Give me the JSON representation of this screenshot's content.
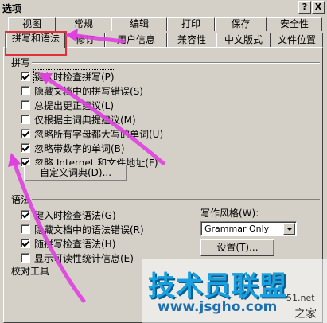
{
  "window": {
    "title": "选项",
    "help_btn": "?",
    "close_btn": "X"
  },
  "tabs_row1": [
    "视图",
    "常规",
    "编辑",
    "打印",
    "保存",
    "安全性"
  ],
  "tabs_row2": [
    "拼写和语法",
    "修订",
    "用户信息",
    "兼容性",
    "中文版式",
    "文件位置"
  ],
  "spelling": {
    "group_label": "拼写",
    "options": [
      {
        "label": "键入时检查拼写(P)",
        "checked": true
      },
      {
        "label": "隐藏文档中的拼写错误(S)",
        "checked": false
      },
      {
        "label": "总提出更正建议(L)",
        "checked": false
      },
      {
        "label": "仅根据主词典提建议(M)",
        "checked": false
      },
      {
        "label": "忽略所有字母都大写的单词(U)",
        "checked": true
      },
      {
        "label": "忽略带数字的单词(B)",
        "checked": true
      },
      {
        "label": "忽略 Internet 和文件地址(F)",
        "checked": true
      }
    ],
    "custom_dict_button": "自定义词典(D)..."
  },
  "grammar": {
    "group_label": "语法",
    "options": [
      {
        "label": "键入时检查语法(G)",
        "checked": true
      },
      {
        "label": "隐藏文档中的语法错误(R)",
        "checked": false
      },
      {
        "label": "随拼写检查语法(H)",
        "checked": true
      },
      {
        "label": "显示可读性统计信息(E)",
        "checked": false
      }
    ],
    "style_label": "写作风格(W):",
    "style_value": "Grammar Only",
    "settings_button": "设置(T)..."
  },
  "proofing": {
    "group_label": "校对工具"
  },
  "watermark": {
    "brand": "技术员联盟",
    "url": "www.jsgho.com",
    "corner1": "51.net",
    "corner2": "之家"
  },
  "colors": {
    "dialog_bg": "#d4d0c8",
    "highlight_red": "#e0303a",
    "arrow_magenta": "#e040e0",
    "watermark_blue": "#1aa0e0"
  }
}
